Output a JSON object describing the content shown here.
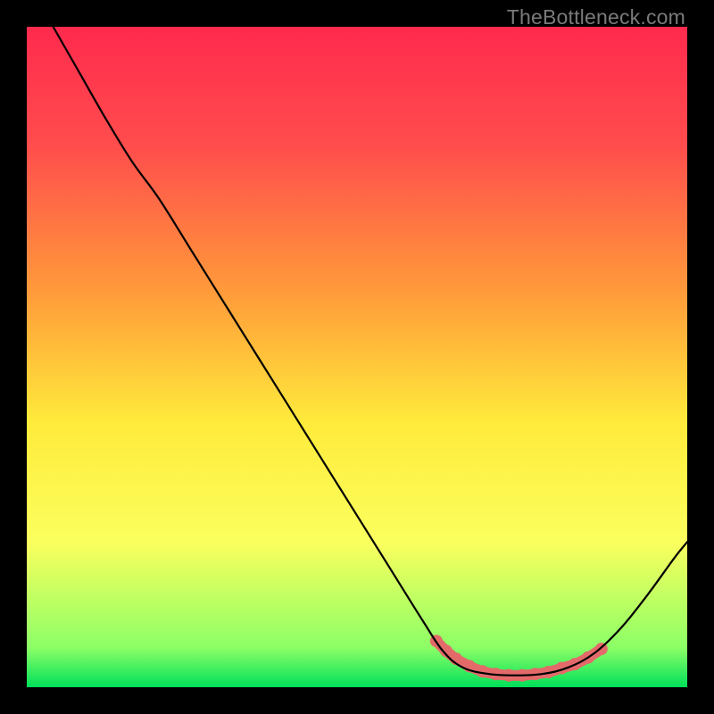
{
  "watermark": "TheBottleneck.com",
  "chart_data": {
    "type": "line",
    "title": "",
    "xlabel": "",
    "ylabel": "",
    "xlim": [
      0,
      100
    ],
    "ylim": [
      0,
      100
    ],
    "gradient_stops": [
      {
        "offset": 0.0,
        "color": "#ff2a4d"
      },
      {
        "offset": 0.18,
        "color": "#ff4d4d"
      },
      {
        "offset": 0.4,
        "color": "#ff9a3a"
      },
      {
        "offset": 0.6,
        "color": "#ffeb3b"
      },
      {
        "offset": 0.78,
        "color": "#fbff5e"
      },
      {
        "offset": 0.94,
        "color": "#8cff66"
      },
      {
        "offset": 1.0,
        "color": "#00e05a"
      }
    ],
    "curve": [
      {
        "x": 4.0,
        "y": 100.0
      },
      {
        "x": 8.0,
        "y": 93.0
      },
      {
        "x": 12.0,
        "y": 86.0
      },
      {
        "x": 16.0,
        "y": 79.5
      },
      {
        "x": 20.0,
        "y": 74.0
      },
      {
        "x": 25.0,
        "y": 66.0
      },
      {
        "x": 30.0,
        "y": 58.0
      },
      {
        "x": 35.0,
        "y": 50.0
      },
      {
        "x": 40.0,
        "y": 42.0
      },
      {
        "x": 45.0,
        "y": 34.0
      },
      {
        "x": 50.0,
        "y": 26.0
      },
      {
        "x": 55.0,
        "y": 18.0
      },
      {
        "x": 60.0,
        "y": 10.0
      },
      {
        "x": 63.0,
        "y": 5.5
      },
      {
        "x": 66.0,
        "y": 3.0
      },
      {
        "x": 70.0,
        "y": 2.0
      },
      {
        "x": 74.0,
        "y": 1.8
      },
      {
        "x": 78.0,
        "y": 2.0
      },
      {
        "x": 82.0,
        "y": 3.0
      },
      {
        "x": 86.0,
        "y": 5.2
      },
      {
        "x": 90.0,
        "y": 9.0
      },
      {
        "x": 94.0,
        "y": 14.0
      },
      {
        "x": 98.0,
        "y": 19.5
      },
      {
        "x": 100.0,
        "y": 22.0
      }
    ],
    "highlight_range": {
      "start_x": 62.0,
      "end_x": 87.0
    },
    "highlight_points": [
      {
        "x": 62.0,
        "y": 7.0
      },
      {
        "x": 63.5,
        "y": 5.5
      },
      {
        "x": 65.0,
        "y": 4.3
      },
      {
        "x": 67.0,
        "y": 3.2
      },
      {
        "x": 69.0,
        "y": 2.4
      },
      {
        "x": 71.0,
        "y": 2.0
      },
      {
        "x": 73.0,
        "y": 1.8
      },
      {
        "x": 75.0,
        "y": 1.8
      },
      {
        "x": 77.0,
        "y": 2.0
      },
      {
        "x": 79.0,
        "y": 2.3
      },
      {
        "x": 81.0,
        "y": 2.9
      },
      {
        "x": 83.0,
        "y": 3.5
      },
      {
        "x": 85.0,
        "y": 4.5
      },
      {
        "x": 87.0,
        "y": 5.8
      }
    ],
    "colors": {
      "curve": "#000000",
      "highlight": "#e46a6a",
      "frame_bg": "#000000"
    }
  }
}
